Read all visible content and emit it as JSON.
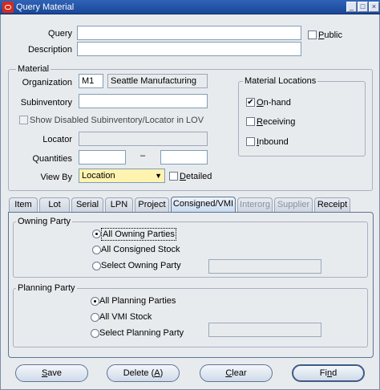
{
  "window": {
    "title": "Query Material",
    "btn_minimize": "_",
    "btn_maximize": "□",
    "btn_close": "×"
  },
  "query": {
    "query_label": "Query",
    "query_value": "",
    "public_label_u": "P",
    "public_label_rest": "ublic",
    "public_checked": false,
    "description_label": "Description",
    "description_value": ""
  },
  "material": {
    "group_title": "Material",
    "organization_label": "Organization",
    "organization_code": "M1",
    "organization_name": "Seattle Manufacturing",
    "subinventory_label": "Subinventory",
    "subinventory_value": "",
    "show_disabled_label": "Show Disabled Subinventory/Locator in LOV",
    "locator_label": "Locator",
    "locator_value": "",
    "quantities_label": "Quantities",
    "quantities_from": "",
    "quantities_dash": "–",
    "quantities_to": "",
    "view_by_label": "View By",
    "view_by_value": "Location",
    "detailed_label_u": "D",
    "detailed_label_rest": "etailed",
    "detailed_checked": false
  },
  "locations": {
    "group_title": "Material Locations",
    "onhand_u": "O",
    "onhand_rest": "n-hand",
    "onhand_checked": true,
    "onhand_mark": "✔",
    "receiving_u": "R",
    "receiving_rest": "eceiving",
    "receiving_checked": false,
    "inbound_u": "I",
    "inbound_rest": "nbound",
    "inbound_checked": false
  },
  "tabs": [
    {
      "label": "Item",
      "state": "normal"
    },
    {
      "label": "Lot",
      "state": "normal"
    },
    {
      "label": "Serial",
      "state": "normal"
    },
    {
      "label": "LPN",
      "state": "normal"
    },
    {
      "label": "Project",
      "state": "normal"
    },
    {
      "label": "Consigned/VMI",
      "state": "active"
    },
    {
      "label": "Interorg",
      "state": "disabled"
    },
    {
      "label": "Supplier",
      "state": "disabled"
    },
    {
      "label": "Receipt",
      "state": "normal"
    }
  ],
  "owning_party": {
    "group_title": "Owning Party",
    "opt1": "All Owning Parties",
    "opt2": "All Consigned Stock",
    "opt3": "Select Owning Party",
    "selected": 1,
    "select_value": ""
  },
  "planning_party": {
    "group_title": "Planning Party",
    "opt1": "All Planning Parties",
    "opt2": "All VMI Stock",
    "opt3": "Select Planning Party",
    "selected": 1,
    "select_value": ""
  },
  "buttons": {
    "save_u": "S",
    "save_rest": "ave",
    "delete_pre": "Delete (",
    "delete_u": "A",
    "delete_post": ")",
    "clear_u": "C",
    "clear_rest": "lear",
    "find_pre": "Fi",
    "find_u": "n",
    "find_post": "d"
  }
}
